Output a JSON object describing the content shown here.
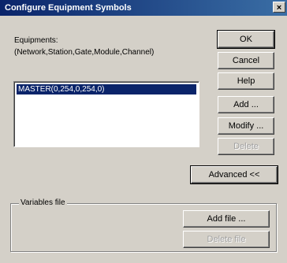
{
  "window": {
    "title": "Configure Equipment Symbols",
    "close_label": "×"
  },
  "equipments": {
    "label": "Equipments:",
    "format": "(Network,Station,Gate,Module,Channel)",
    "items": [
      "MASTER(0,254,0,254,0)"
    ]
  },
  "buttons": {
    "ok": "OK",
    "cancel": "Cancel",
    "help": "Help",
    "add": "Add ...",
    "modify": "Modify ...",
    "delete": "Delete",
    "advanced": "Advanced <<"
  },
  "variables": {
    "group_label": "Variables file",
    "add_file": "Add file ...",
    "delete_file": "Delete file"
  }
}
